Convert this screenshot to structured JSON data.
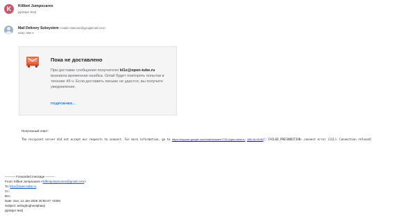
{
  "thread": {
    "avatar_letter": "K",
    "title": "Killbot Jumpscares",
    "subtitle": "jsjsbsjer test)"
  },
  "message": {
    "sender_name": "Mail Delivery Subsystem",
    "sender_email": "<mailer-daemon@googlemail.com>",
    "recipient_label": "кому: мне",
    "recipient_caret": "▾"
  },
  "bounce": {
    "title": "Пока не доставлено",
    "body_prefix": "При доставке сообщения получателю ",
    "recipient": "kl1x@open-tube.ru",
    "body_suffix": " возникла временная ошибка. Gmail будет повторять попытки в течение 45 ч. Если доставить письмо не удастся, вы получите уведомление.",
    "more_link": "ПОДРОБНЕЕ...",
    "icon": "warning-envelope-icon",
    "icon_color": "#e8603c"
  },
  "response": {
    "label": "Полученный ответ:",
    "text_prefix": "The recipient server did not accept our requests to connect. For more information, go to ",
    "link1": "https://support.google.com/mail/answer/7720 [open-tube.ru",
    "between": " ",
    "link2": "185.16.09.55",
    "text_suffix": "]: FAILED_PRECONDITION: connect error (111): Connection refused]"
  },
  "forwarded": {
    "header": "---------- Forwarded message ---------",
    "from_label": "From: Killbot Jumpscares <",
    "from_email": "killbotjumpscares@gmail.com",
    "from_end": ">",
    "to_label": "To: ",
    "to_email": "kl1x@open-tube.ru",
    "cc": "Cc:",
    "bcc": "Bcc:",
    "date": "Date: Sun, 12 Jan 2025 20:50:47 +0300",
    "subject": "Subject: anhsghuqhneiqhaeji",
    "body": "jsjsbsjer test)"
  }
}
